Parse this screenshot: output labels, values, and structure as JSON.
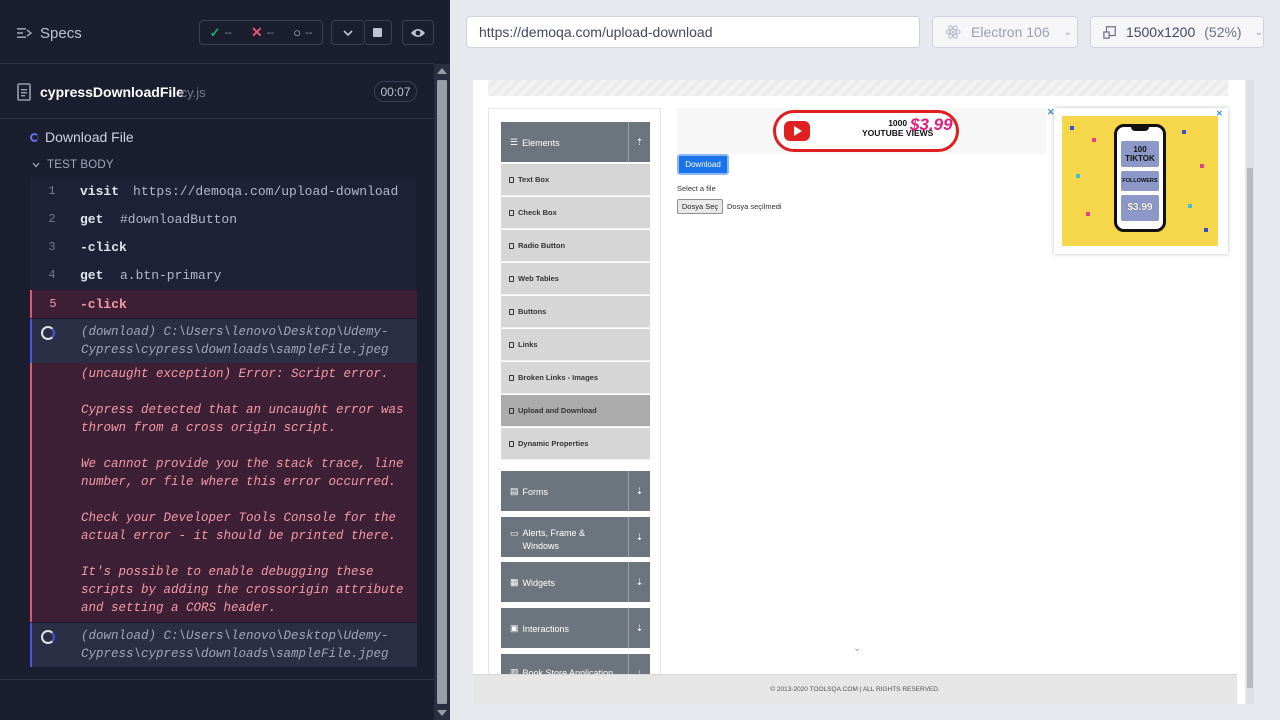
{
  "reporter": {
    "specs_label": "Specs",
    "stats": {
      "passed": "--",
      "failed": "--",
      "pending": "--"
    },
    "spec_file": {
      "name": "cypressDownloadFile",
      "ext": ".cy.js",
      "duration": "00:07"
    },
    "test_title": "Download File",
    "section_title": "TEST BODY",
    "commands": [
      {
        "num": "1",
        "name": "visit",
        "arg": "https://demoqa.com/upload-download"
      },
      {
        "num": "2",
        "name": "get",
        "arg": "#downloadButton"
      },
      {
        "num": "3",
        "name": "-click",
        "arg": ""
      },
      {
        "num": "4",
        "name": "get",
        "arg": "a.btn-primary"
      },
      {
        "num": "5",
        "name": "-click",
        "arg": ""
      }
    ],
    "download_log_1": "(download)  C:\\Users\\lenovo\\Desktop\\Udemy-Cypress\\cypress\\downloads\\sampleFile.jpeg",
    "error_text": "(uncaught exception)  Error: Script error.\n\nCypress detected that an uncaught error was thrown from a cross origin script.\n\nWe cannot provide you the stack trace, line number, or file where this error occurred.\n\nCheck your Developer Tools Console for the actual error - it should be printed there.\n\nIt's possible to enable debugging these scripts by adding the crossorigin attribute and setting a CORS header.",
    "download_log_2": "(download)  C:\\Users\\lenovo\\Desktop\\Udemy-Cypress\\cypress\\downloads\\sampleFile.jpeg"
  },
  "aut": {
    "url": "https://demoqa.com/upload-download",
    "browser": "Electron 106",
    "viewport": "1500x1200",
    "viewport_scale": "(52%)",
    "page": {
      "groups": [
        {
          "label": "Elements"
        },
        {
          "label": "Forms"
        },
        {
          "label": "Alerts, Frame & Windows"
        },
        {
          "label": "Widgets"
        },
        {
          "label": "Interactions"
        },
        {
          "label": "Book Store Application"
        }
      ],
      "menu_items": [
        "Text Box",
        "Check Box",
        "Radio Button",
        "Web Tables",
        "Buttons",
        "Links",
        "Broken Links - Images",
        "Upload and Download",
        "Dynamic Properties"
      ],
      "active_item": "Upload and Download",
      "yt_ad": {
        "line1": "1000",
        "line2": "YOUTUBE VIEWS",
        "price": "$3.99"
      },
      "tt_ad": {
        "line1": "100",
        "line2": "TIKTOK",
        "line3": "FOLLOWERS",
        "price": "$3.99"
      },
      "download_button": "Download",
      "select_label": "Select a file",
      "file_button": "Dosya Seç",
      "file_status": "Dosya seçilmedi",
      "footer": "© 2013-2020 TOOLSQA.COM | ALL RIGHTS RESERVED."
    }
  },
  "colors": {
    "accent": "#6470f3",
    "fail": "#e45770",
    "pass": "#1fa971",
    "download_btn": "#1a73e8"
  }
}
